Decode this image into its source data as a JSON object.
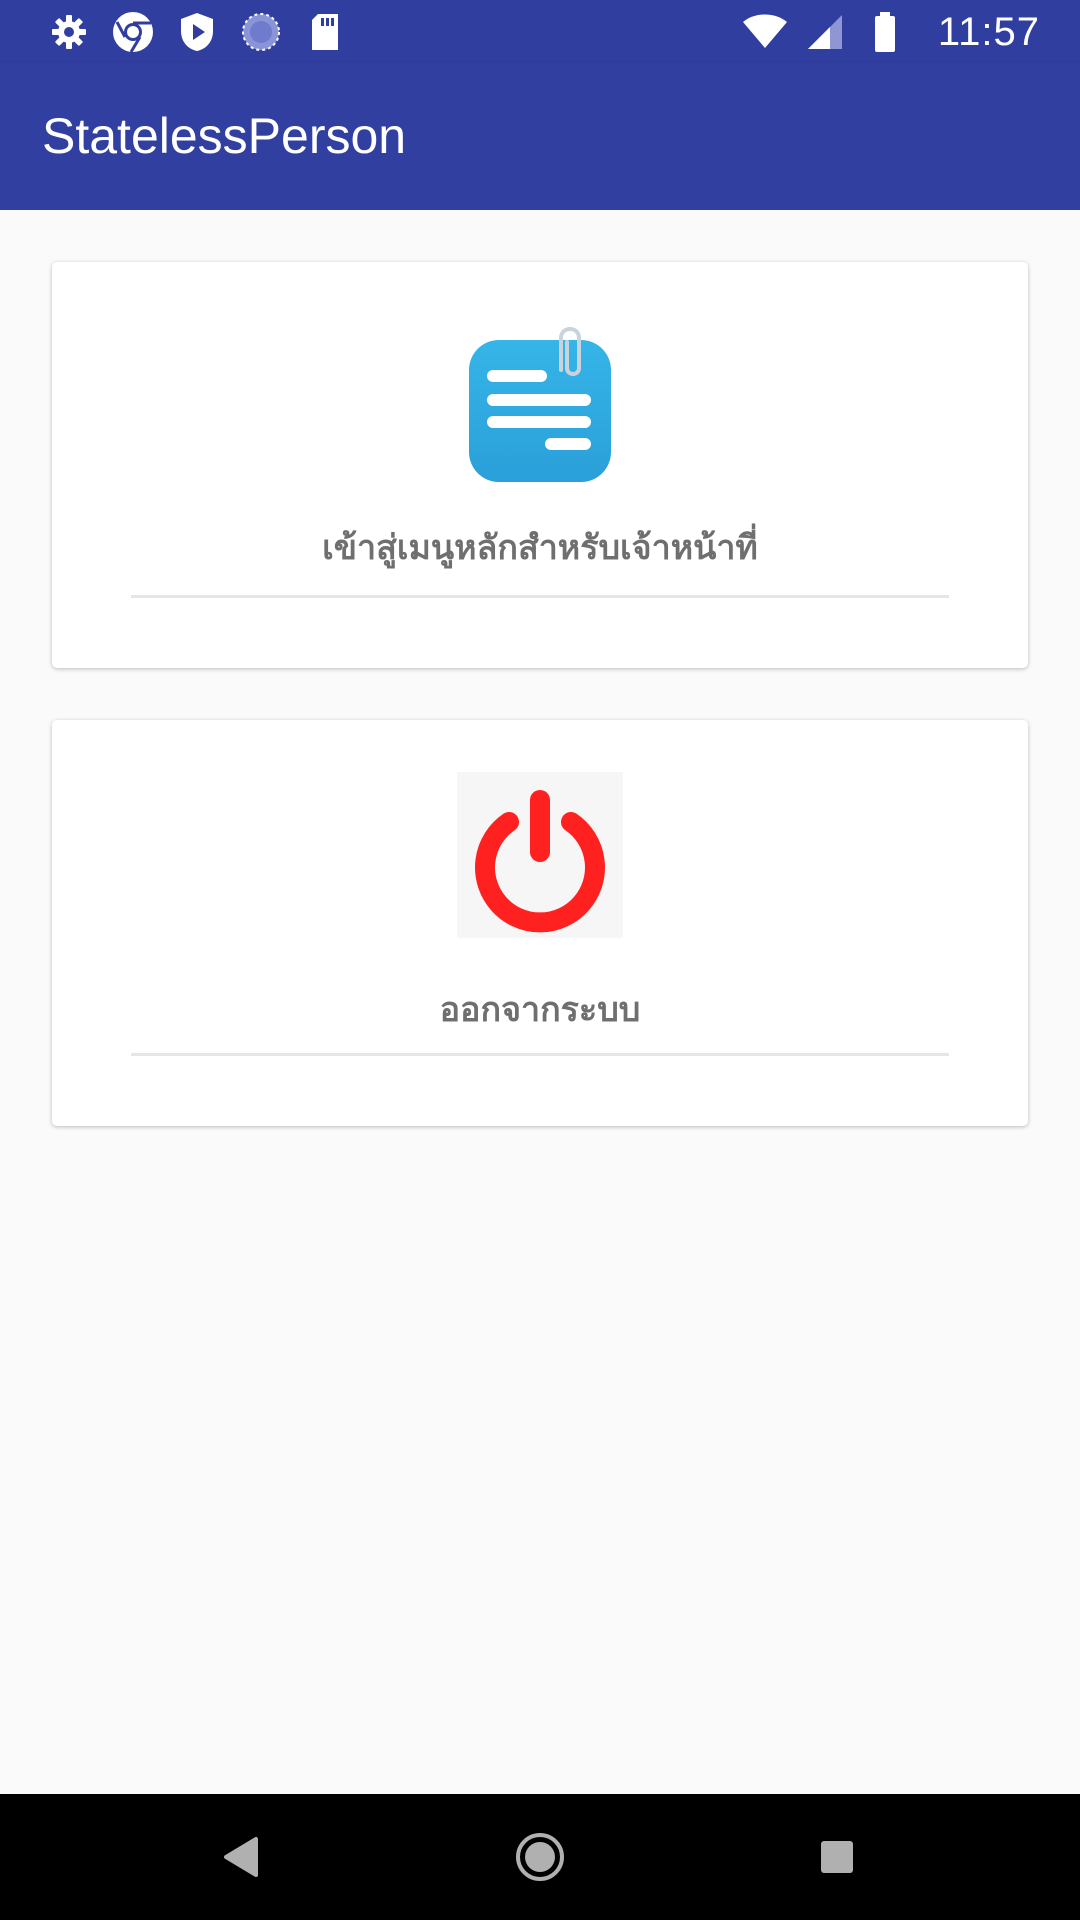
{
  "status_bar": {
    "time": "11:57",
    "left_icons": [
      "settings-icon",
      "chrome-icon",
      "shield-play-icon",
      "sync-icon",
      "sd-card-icon"
    ],
    "right_icons": [
      "wifi-icon",
      "cell-signal-icon",
      "battery-icon"
    ]
  },
  "app_bar": {
    "title": "StatelessPerson"
  },
  "menu": {
    "items": [
      {
        "label": "เข้าสู่เมนูหลักสำหรับเจ้าหน้าที่",
        "icon": "document-clip-icon"
      },
      {
        "label": "ออกจากระบบ",
        "icon": "power-icon"
      }
    ]
  },
  "nav_bar": {
    "buttons": [
      "back-button",
      "home-button",
      "recents-button"
    ]
  },
  "colors": {
    "app_bar": "#3140a0",
    "status_bar": "#303f9f",
    "doc_icon": "#2fa8e0",
    "power_icon": "#ff2020",
    "label_text": "#6f6f6f",
    "background": "#fafafa"
  }
}
